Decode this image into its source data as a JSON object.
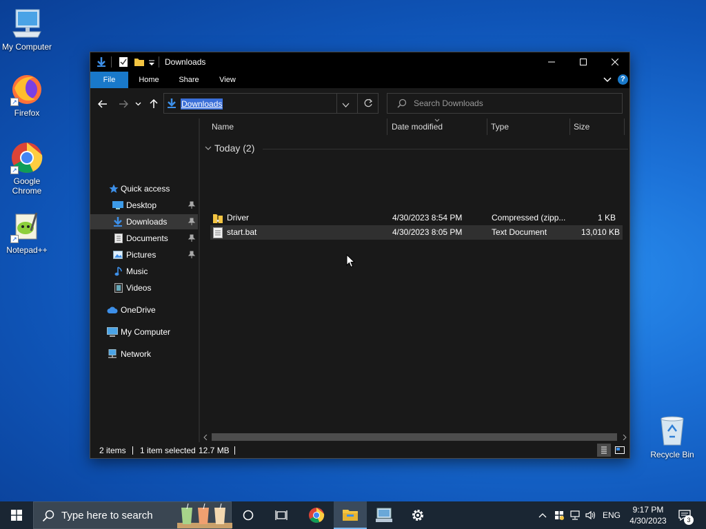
{
  "desktop": {
    "icons": [
      {
        "label": "My Computer"
      },
      {
        "label": "Firefox"
      },
      {
        "label": "Google Chrome"
      },
      {
        "label": "Notepad++"
      },
      {
        "label": "Recycle Bin"
      }
    ]
  },
  "window": {
    "title": "Downloads",
    "ribbon_tabs": [
      "File",
      "Home",
      "Share",
      "View"
    ],
    "address": "Downloads",
    "search_placeholder": "Search Downloads",
    "nav": {
      "quick_access": "Quick access",
      "items": [
        "Desktop",
        "Downloads",
        "Documents",
        "Pictures",
        "Music",
        "Videos"
      ],
      "onedrive": "OneDrive",
      "my_computer": "My Computer",
      "network": "Network"
    },
    "columns": {
      "name": "Name",
      "date": "Date modified",
      "type": "Type",
      "size": "Size"
    },
    "group": "Today (2)",
    "files": [
      {
        "name": "Driver",
        "date": "4/30/2023 8:54 PM",
        "type": "Compressed (zipp...",
        "size": "1 KB"
      },
      {
        "name": "start.bat",
        "date": "4/30/2023 8:05 PM",
        "type": "Text Document",
        "size": "13,010 KB"
      }
    ],
    "status": {
      "items": "2 items",
      "selected": "1 item selected",
      "size": "12.7 MB"
    }
  },
  "taskbar": {
    "search_placeholder": "Type here to search",
    "language": "ENG",
    "time": "9:17 PM",
    "date": "4/30/2023",
    "notification_count": "3"
  },
  "colors": {
    "accent": "#1979ca",
    "window_bg": "#191919",
    "taskbar_bg": "#1a2633"
  }
}
